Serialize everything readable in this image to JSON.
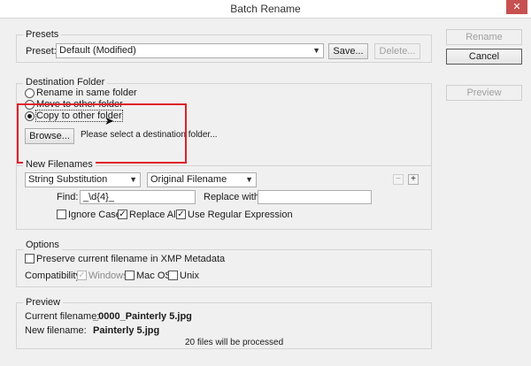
{
  "window": {
    "title": "Batch Rename",
    "close_glyph": "✕"
  },
  "presets": {
    "group_label": "Presets",
    "preset_label": "Preset:",
    "selected": "Default (Modified)",
    "save_label": "Save...",
    "delete_label": "Delete..."
  },
  "side_buttons": {
    "rename": "Rename",
    "cancel": "Cancel",
    "preview": "Preview"
  },
  "destination": {
    "group_label": "Destination Folder",
    "option_same": "Rename in same folder",
    "option_move": "Move to other folder",
    "option_copy": "Copy to other folder",
    "selected": "copy",
    "browse_label": "Browse...",
    "status_text": "Please select a destination folder..."
  },
  "new_filenames": {
    "group_label": "New Filenames",
    "method": "String Substitution",
    "source": "Original Filename",
    "find_label": "Find:",
    "find_value": "_\\d{4}_",
    "replace_label": "Replace with:",
    "replace_value": "",
    "ignore_case_label": "Ignore Case",
    "ignore_case": false,
    "replace_all_label": "Replace All",
    "replace_all": true,
    "regex_label": "Use Regular Expression",
    "regex": true,
    "remove_glyph": "−",
    "add_glyph": "+"
  },
  "options": {
    "group_label": "Options",
    "preserve_label": "Preserve current filename in XMP Metadata",
    "preserve": false,
    "compat_label": "Compatibility:",
    "windows_label": "Windows",
    "windows": true,
    "macos_label": "Mac OS",
    "macos": false,
    "unix_label": "Unix",
    "unix": false
  },
  "preview": {
    "group_label": "Preview",
    "current_label": "Current filename:",
    "current_value": "_0000_Painterly 5.jpg",
    "new_label": "New filename:",
    "new_value": "Painterly 5.jpg",
    "files_processed": "20 files will be processed"
  },
  "colors": {
    "highlight_box": "#e0202a",
    "dialog_bg": "#f0f0f0"
  }
}
